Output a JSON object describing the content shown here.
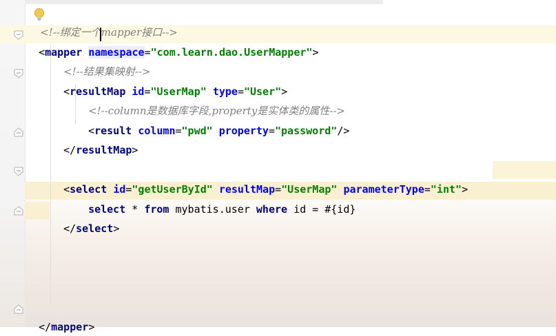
{
  "editor": {
    "comment_bind": "<!--绑定一个mapper接口-->",
    "mapper_open_tag": "mapper",
    "mapper_ns_attr": "namespace",
    "mapper_ns_val": "\"com.learn.dao.UserMapper\"",
    "comment_result": "<!--结果集映射-->",
    "resultmap_tag": "resultMap",
    "resultmap_id_attr": "id",
    "resultmap_id_val": "\"UserMap\"",
    "resultmap_type_attr": "type",
    "resultmap_type_val": "\"User\"",
    "comment_column": "<!--column是数据库字段,property是实体类的属性-->",
    "result_tag": "result",
    "result_col_attr": "column",
    "result_col_val": "\"pwd\"",
    "result_prop_attr": "property",
    "result_prop_val": "\"password\"",
    "resultmap_close_tag": "resultMap",
    "select_tag": "select",
    "select_id_attr": "id",
    "select_id_val": "\"getUserById\"",
    "select_rm_attr": "resultMap",
    "select_rm_val": "\"UserMap\"",
    "select_pt_attr": "parameterType",
    "select_pt_val": "\"int\"",
    "sql_select": "select",
    "sql_star": " * ",
    "sql_from": "from",
    "sql_table": " mybatis.user ",
    "sql_where": "where",
    "sql_rest": " id = #{id}",
    "select_close_tag": "select",
    "mapper_close_tag": "mapper"
  }
}
